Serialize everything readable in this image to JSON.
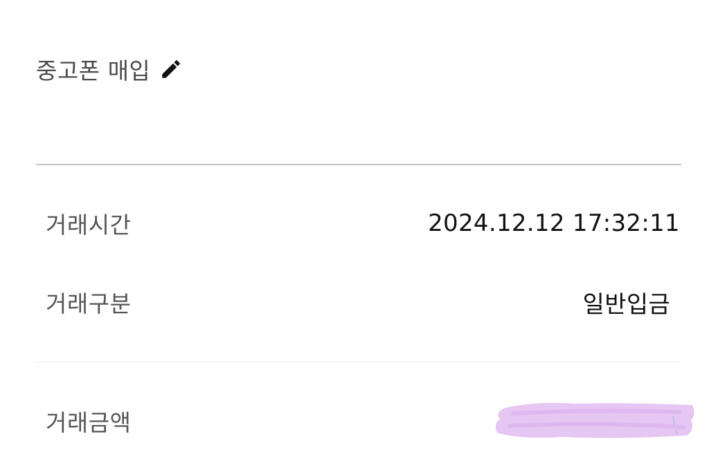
{
  "memo": {
    "title": "중고폰 매입",
    "edit_icon": "pencil-icon"
  },
  "details": {
    "time_label": "거래시간",
    "time_value": "2024.12.12 17:32:11",
    "type_label": "거래구분",
    "type_value": "일반입금",
    "amount_label": "거래금액",
    "amount_value_redacted": true
  },
  "colors": {
    "redaction_marker": "#e6c6f3",
    "divider": "#c4c4c4"
  }
}
